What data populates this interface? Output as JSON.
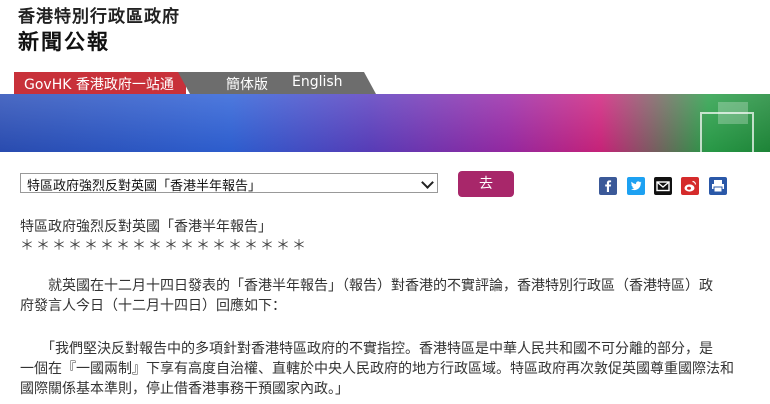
{
  "header": {
    "line1": "香港特別行政區政府",
    "line2": "新聞公報"
  },
  "nav": {
    "govhk": "GovHK 香港政府一站通",
    "simplified": "簡体版",
    "english": "English"
  },
  "select": {
    "value": "特區政府強烈反對英國「香港半年報告」"
  },
  "go_button": "去",
  "share_icons": [
    "facebook-icon",
    "twitter-icon",
    "email-icon",
    "weibo-icon",
    "print-icon"
  ],
  "colors": {
    "nav_red": "#c8313a",
    "nav_grey": "#6d6d6d",
    "go_button": "#a8276a"
  },
  "article": {
    "title": "特區政府強烈反對英國「香港半年報告」",
    "stars": "＊＊＊＊＊＊＊＊＊＊＊＊＊＊＊＊＊＊",
    "para1_line1": "　　就英國在十二月十四日發表的「香港半年報告」（報告）對香港的不實評論，香港特別行政區（香港特區）政",
    "para1_line2": "府發言人今日（十二月十四日）回應如下：",
    "para2_line1": "　　「我們堅決反對報告中的多項針對香港特區政府的不實指控。香港特區是中華人民共和國不可分離的部分，是",
    "para2_line2": "一個在『一國兩制』下享有高度自治權、直轄於中央人民政府的地方行政區域。特區政府再次敦促英國尊重國際法和",
    "para2_line3": "國際關係基本準則，停止借香港事務干預國家內政。」"
  }
}
